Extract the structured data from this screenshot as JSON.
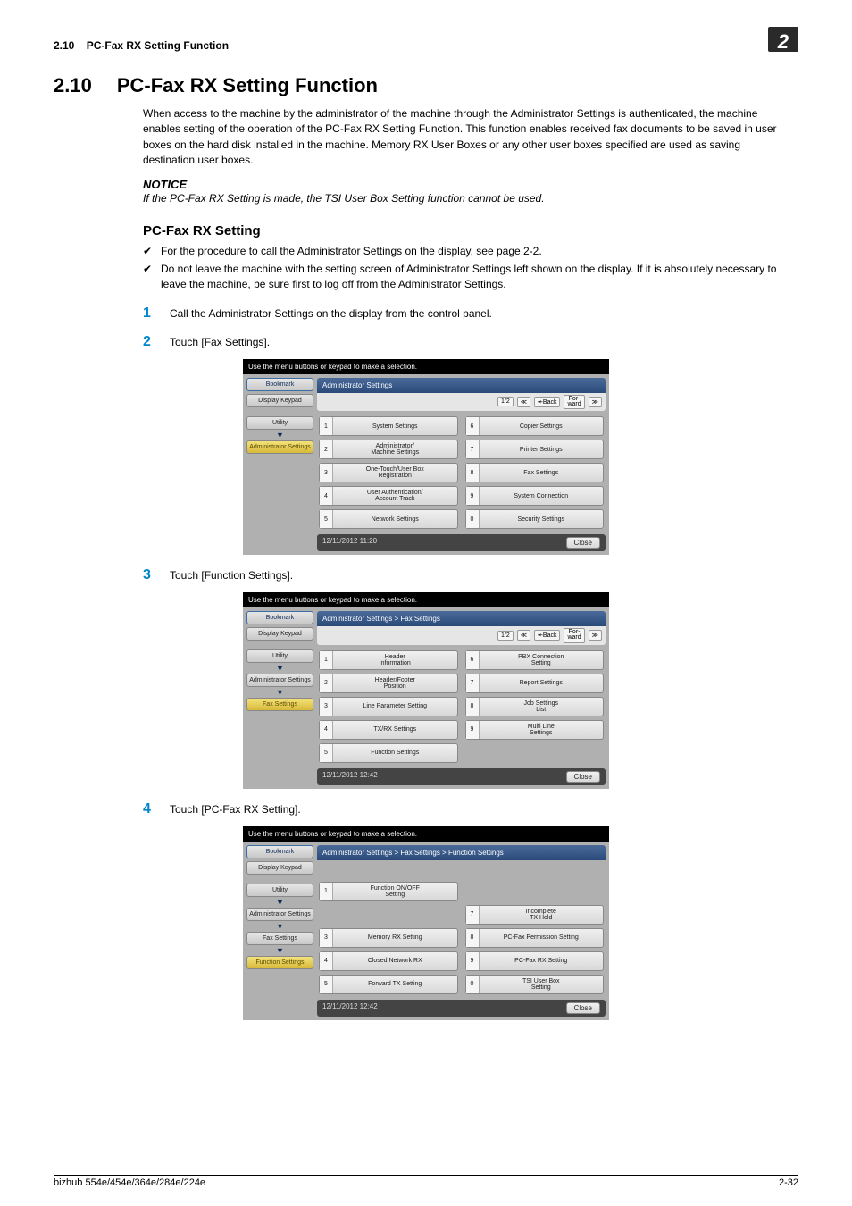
{
  "header": {
    "section_no_top": "2.10",
    "section_title_top": "PC-Fax RX Setting Function",
    "chapter_badge": "2"
  },
  "heading": {
    "num": "2.10",
    "title": "PC-Fax RX Setting Function"
  },
  "intro": "When access to the machine by the administrator of the machine through the Administrator Settings is authenticated, the machine enables setting of the operation of the PC-Fax RX Setting Function. This function enables received fax documents to be saved in user boxes on the hard disk installed in the machine. Memory RX User Boxes or any other user boxes specified are used as saving destination user boxes.",
  "notice": {
    "label": "NOTICE",
    "body": "If the PC-Fax RX Setting is made, the TSI User Box Setting function cannot be used."
  },
  "subhead": "PC-Fax RX Setting",
  "checks": [
    "For the procedure to call the Administrator Settings on the display, see page 2-2.",
    "Do not leave the machine with the setting screen of Administrator Settings left shown on the display. If it is absolutely necessary to leave the machine, be sure first to log off from the Administrator Settings."
  ],
  "steps": [
    {
      "n": "1",
      "text": "Call the Administrator Settings on the display from the control panel."
    },
    {
      "n": "2",
      "text": "Touch [Fax Settings]."
    },
    {
      "n": "3",
      "text": "Touch [Function Settings]."
    },
    {
      "n": "4",
      "text": "Touch [PC-Fax RX Setting]."
    }
  ],
  "shot_common": {
    "instruction": "Use the menu buttons or keypad to make a selection.",
    "tabs": {
      "bookmark": "Bookmark",
      "keypad": "Display Keypad",
      "utility": "Utility",
      "admin": "Administrator Settings",
      "fax": "Fax Settings",
      "func": "Function Settings"
    },
    "page_ind": "1/2",
    "back": "↞Back",
    "forw": "For-\nward",
    "close": "Close"
  },
  "shot1": {
    "crumb": "Administrator Settings",
    "items": [
      {
        "n": "1",
        "l": "System Settings"
      },
      {
        "n": "6",
        "l": "Copier Settings"
      },
      {
        "n": "2",
        "l": "Administrator/\nMachine Settings"
      },
      {
        "n": "7",
        "l": "Printer Settings"
      },
      {
        "n": "3",
        "l": "One-Touch/User Box\nRegistration"
      },
      {
        "n": "8",
        "l": "Fax Settings"
      },
      {
        "n": "4",
        "l": "User Authentication/\nAccount Track"
      },
      {
        "n": "9",
        "l": "System Connection"
      },
      {
        "n": "5",
        "l": "Network Settings"
      },
      {
        "n": "0",
        "l": "Security Settings"
      }
    ],
    "ts": "12/11/2012   11:20"
  },
  "shot2": {
    "crumb": "Administrator Settings  > Fax Settings",
    "items": [
      {
        "n": "1",
        "l": "Header\nInformation"
      },
      {
        "n": "6",
        "l": "PBX Connection\nSetting"
      },
      {
        "n": "2",
        "l": "Header/Footer\nPosition"
      },
      {
        "n": "7",
        "l": "Report Settings"
      },
      {
        "n": "3",
        "l": "Line Parameter Setting"
      },
      {
        "n": "8",
        "l": "Job Settings\nList"
      },
      {
        "n": "4",
        "l": "TX/RX Settings"
      },
      {
        "n": "9",
        "l": "Multi Line\nSettings"
      },
      {
        "n": "5",
        "l": "Function Settings"
      },
      {
        "n": "",
        "l": "",
        "hidden": true
      }
    ],
    "ts": "12/11/2012   12:42"
  },
  "shot3": {
    "crumb": "Administrator Settings > Fax Settings > Function Settings",
    "items": [
      {
        "n": "1",
        "l": "Function ON/OFF\nSetting"
      },
      {
        "n": "",
        "l": "",
        "hidden": true
      },
      {
        "n": "",
        "l": "",
        "hidden": true
      },
      {
        "n": "7",
        "l": "Incomplete\nTX Hold"
      },
      {
        "n": "3",
        "l": "Memory RX Setting"
      },
      {
        "n": "8",
        "l": "PC-Fax Permission Setting"
      },
      {
        "n": "4",
        "l": "Closed Network RX"
      },
      {
        "n": "9",
        "l": "PC-Fax RX Setting"
      },
      {
        "n": "5",
        "l": "Forward TX Setting"
      },
      {
        "n": "0",
        "l": "TSI User Box\nSetting"
      }
    ],
    "ts": "12/11/2012   12:42"
  },
  "footer": {
    "left": "bizhub 554e/454e/364e/284e/224e",
    "right": "2-32"
  }
}
